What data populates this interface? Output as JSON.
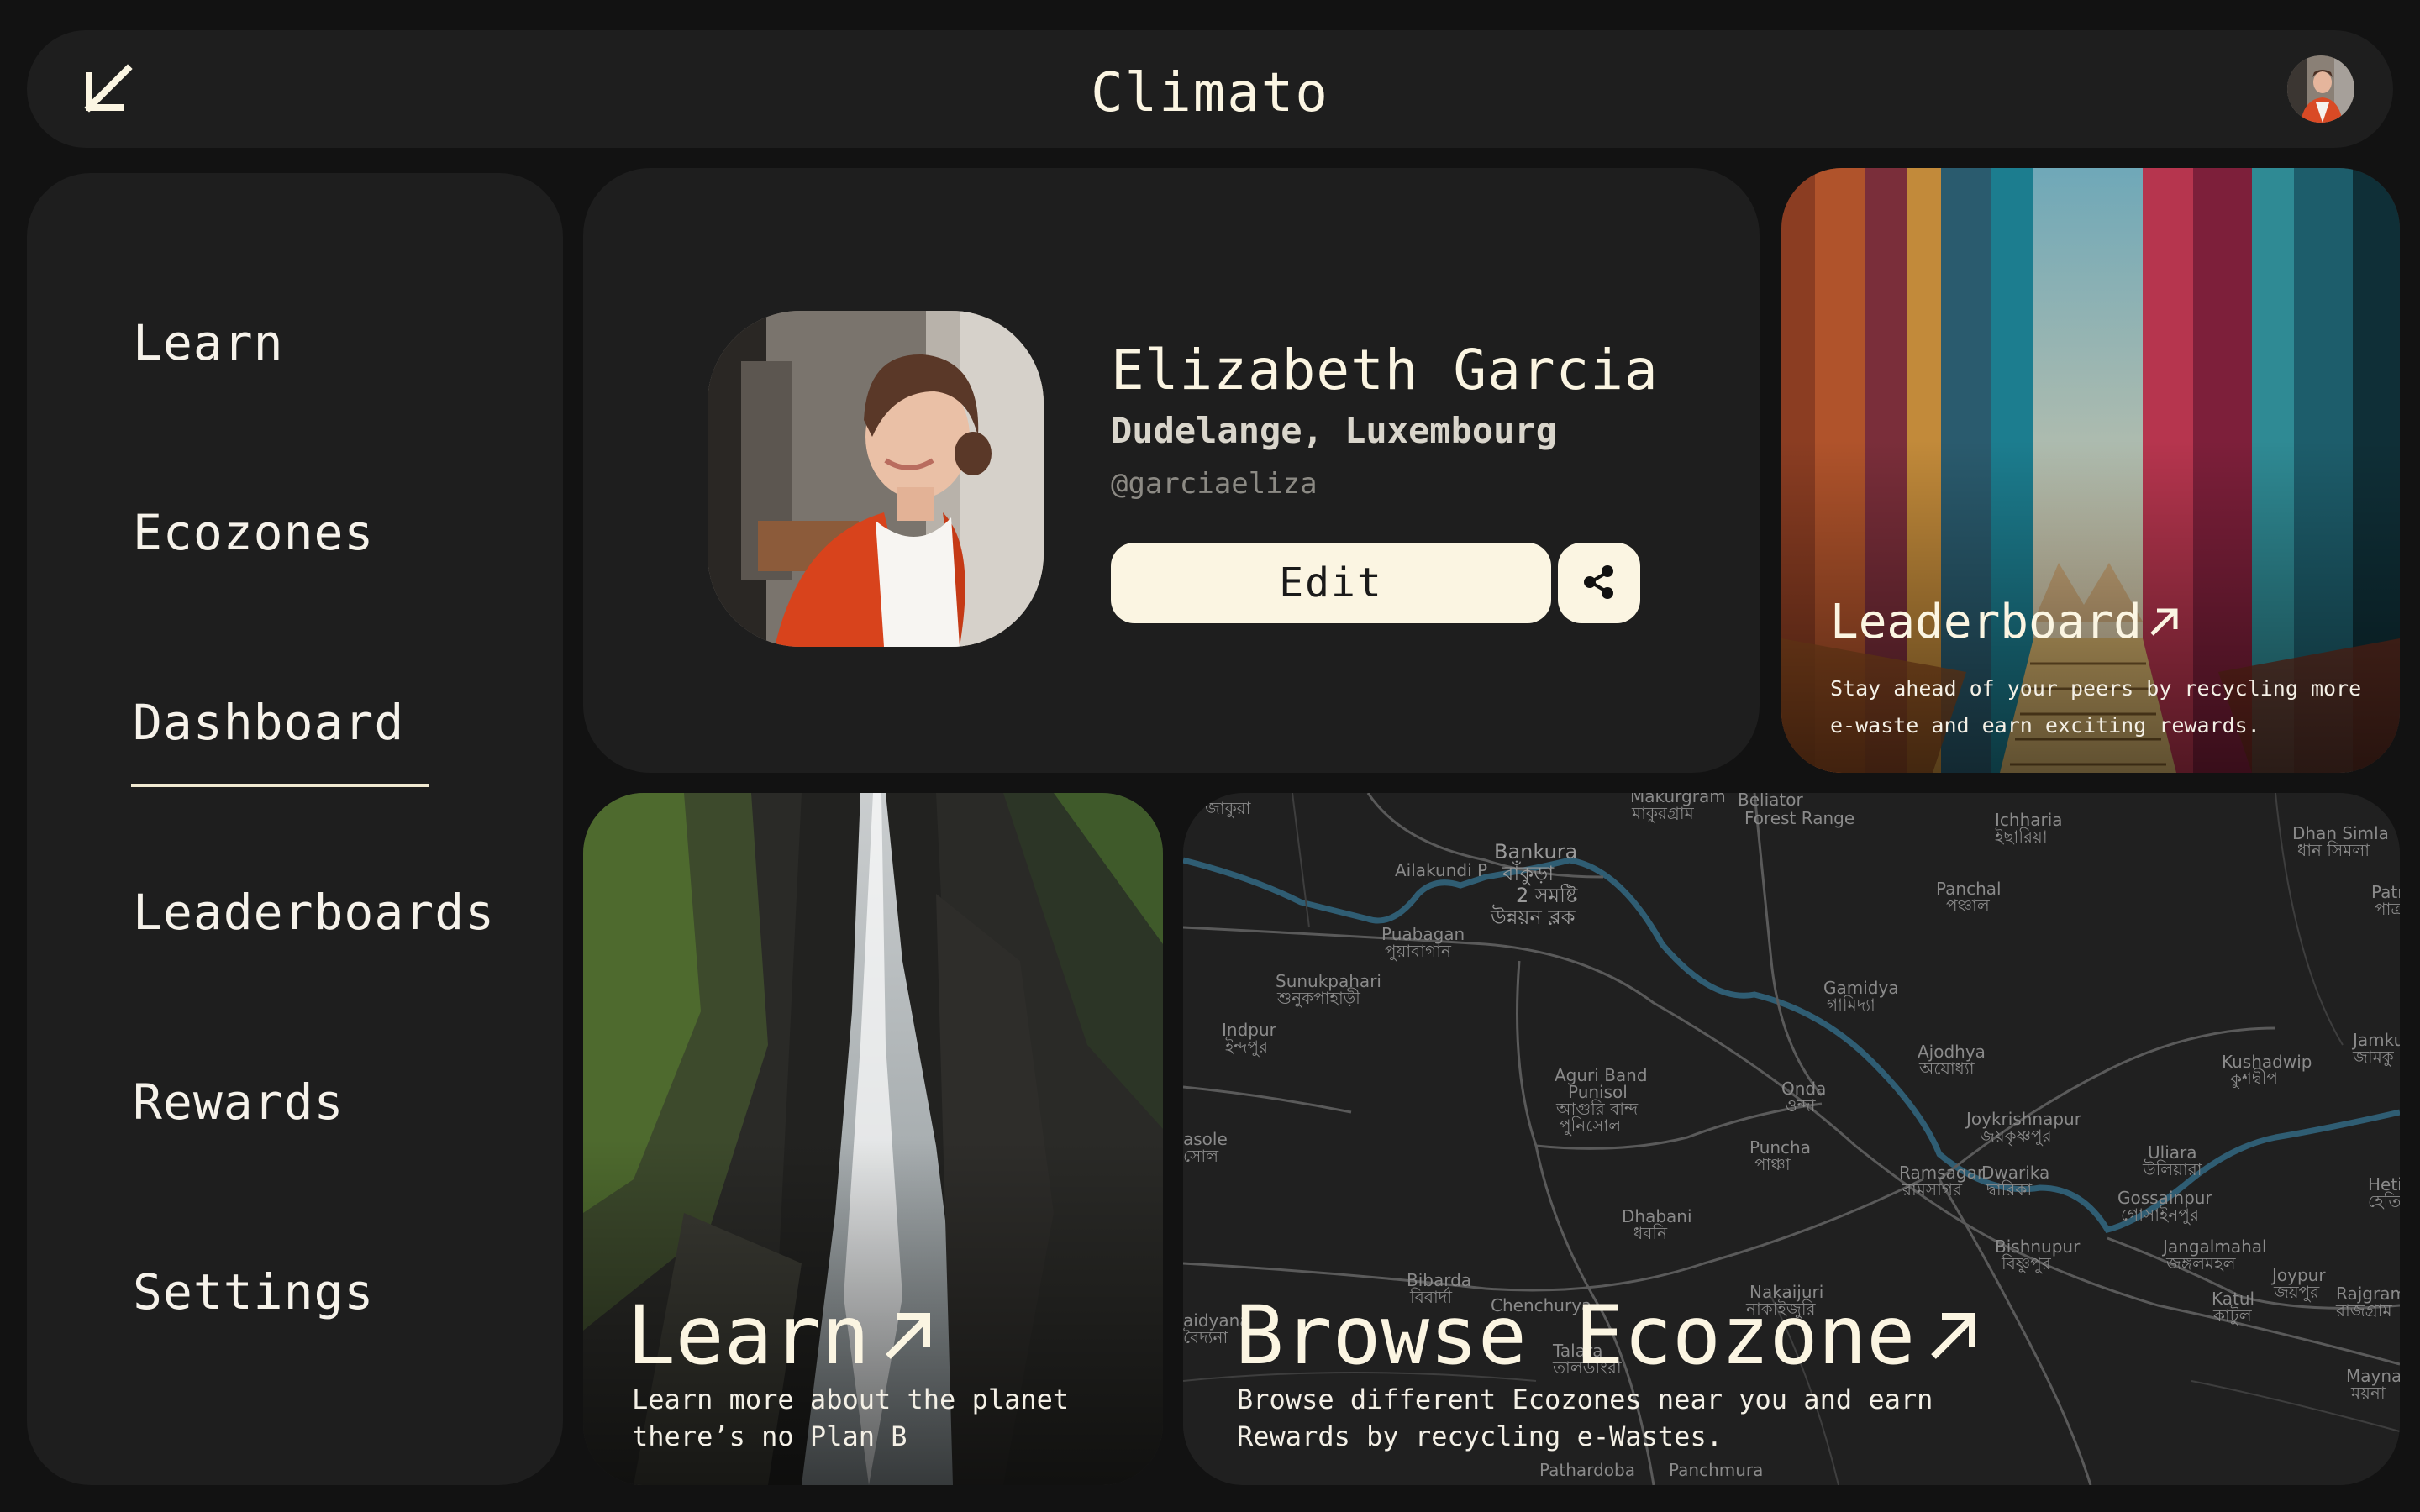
{
  "header": {
    "title": "Climato",
    "back_icon": "arrow-down-left-icon"
  },
  "sidebar": {
    "items": [
      {
        "label": "Learn"
      },
      {
        "label": "Ecozones"
      },
      {
        "label": "Dashboard",
        "active": true
      },
      {
        "label": "Leaderboards"
      },
      {
        "label": "Rewards"
      },
      {
        "label": "Settings"
      }
    ]
  },
  "profile": {
    "name": "Elizabeth Garcia",
    "location": "Dudelange, Luxembourg",
    "handle": "@garciaeliza",
    "edit_label": "Edit",
    "share_icon": "share-icon"
  },
  "leaderboard_card": {
    "title": "Leaderboard",
    "description": "Stay ahead of your peers by recycling more e-waste and earn exciting rewards."
  },
  "learn_card": {
    "title": "Learn",
    "description": "Learn more about the planet there’s no Plan B"
  },
  "ecozone_card": {
    "title": "Browse Ecozone",
    "description": "Browse different Ecozones near you and earn Rewards by recycling e-Wastes.",
    "map_labels": [
      {
        "text": "Bankura",
        "major": true
      },
      {
        "text": "বাঁকুড়া",
        "major": true
      },
      {
        "text": "2 সমষ্টি",
        "major": true
      },
      {
        "text": "উন্নয়ন ব্লক",
        "major": true
      },
      {
        "text": "Beliator"
      },
      {
        "text": "Forest Range"
      },
      {
        "text": "Ichharia"
      },
      {
        "text": "ইছারিয়া"
      },
      {
        "text": "Dhan Simla"
      },
      {
        "text": "ধান সিমলা"
      },
      {
        "text": "Ailakundi P"
      },
      {
        "text": "Panchal"
      },
      {
        "text": "পঞ্চাল"
      },
      {
        "text": "Puabagan"
      },
      {
        "text": "পুয়াবাগান"
      },
      {
        "text": "Sunukpahari"
      },
      {
        "text": "শুনুকপাহাড়ী"
      },
      {
        "text": "Gamidya"
      },
      {
        "text": "গামিদ্যা"
      },
      {
        "text": "Indpur"
      },
      {
        "text": "ইন্দপুর"
      },
      {
        "text": "Ajodhya"
      },
      {
        "text": "অযোধ্যা"
      },
      {
        "text": "Kushadwip"
      },
      {
        "text": "কুশদ্বীপ"
      },
      {
        "text": "Jamku"
      },
      {
        "text": "জামকু"
      },
      {
        "text": "Aguri Band"
      },
      {
        "text": "Punisol"
      },
      {
        "text": "আগুরি বান্দ"
      },
      {
        "text": "পুনিসোল"
      },
      {
        "text": "Onda"
      },
      {
        "text": "ওন্দা"
      },
      {
        "text": "Joykrishnapur"
      },
      {
        "text": "জয়কৃষ্ণপুর"
      },
      {
        "text": "Uliara"
      },
      {
        "text": "উলিয়ারা"
      },
      {
        "text": "asole"
      },
      {
        "text": "সোল"
      },
      {
        "text": "Puncha"
      },
      {
        "text": "পাঞ্চা"
      },
      {
        "text": "Ramsagar"
      },
      {
        "text": "রামসাগর"
      },
      {
        "text": "Dwarika"
      },
      {
        "text": "দ্বারিকা"
      },
      {
        "text": "Gossainpur"
      },
      {
        "text": "গোসাইনপুর"
      },
      {
        "text": "Dhabani"
      },
      {
        "text": "ধবনি"
      },
      {
        "text": "Bishnupur"
      },
      {
        "text": "বিষ্ণুপুর"
      },
      {
        "text": "Jangalmahal"
      },
      {
        "text": "জঙ্গলমহল"
      },
      {
        "text": "Joypur"
      },
      {
        "text": "জয়পুর"
      },
      {
        "text": "Bibarda"
      },
      {
        "text": "বিবার্দা"
      },
      {
        "text": "Nakaijuri"
      },
      {
        "text": "নাকাইজুরি"
      },
      {
        "text": "Katul"
      },
      {
        "text": "কাটুল"
      },
      {
        "text": "Rajgram"
      },
      {
        "text": "রাজগ্রাম"
      },
      {
        "text": "Chenchurya"
      },
      {
        "text": "aidyana"
      },
      {
        "text": "বৈদ্যনা"
      },
      {
        "text": "Talara"
      },
      {
        "text": "তালডাংরা"
      },
      {
        "text": "Mayna"
      },
      {
        "text": "ময়না"
      },
      {
        "text": "Pathardoba"
      },
      {
        "text": "Panchmura"
      },
      {
        "text": "Makurgram"
      },
      {
        "text": "মাকুরগ্রাম"
      },
      {
        "text": "জাকুরা"
      },
      {
        "text": "Hetia"
      },
      {
        "text": "হেতিয়া"
      },
      {
        "text": "Patr"
      },
      {
        "text": "পাত্র"
      }
    ]
  },
  "colors": {
    "background": "#121212",
    "panel": "#1e1e1e",
    "accent_cream": "#fbf5e2",
    "river": "#2f5d73"
  }
}
